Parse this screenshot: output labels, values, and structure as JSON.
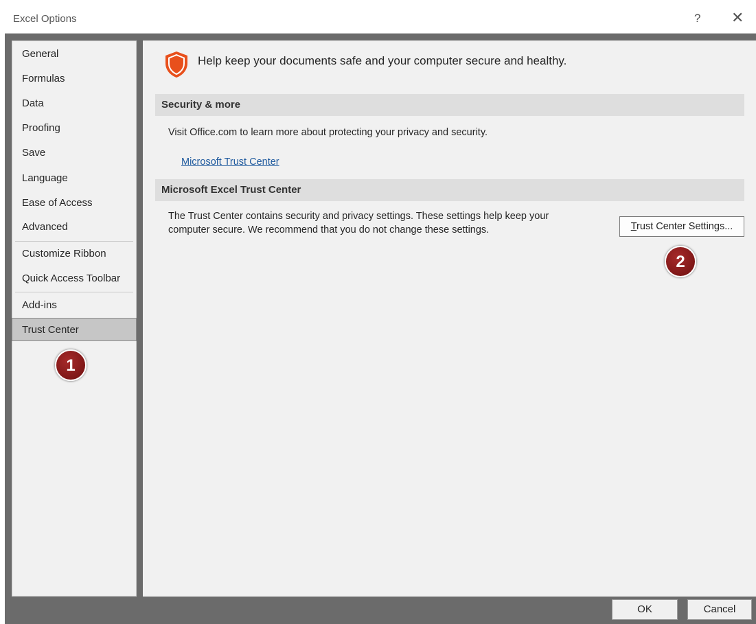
{
  "window": {
    "title": "Excel Options",
    "help_glyph": "?",
    "close_glyph": "✕"
  },
  "sidebar": {
    "items": [
      {
        "label": "General"
      },
      {
        "label": "Formulas"
      },
      {
        "label": "Data"
      },
      {
        "label": "Proofing"
      },
      {
        "label": "Save"
      },
      {
        "label": "Language"
      },
      {
        "label": "Ease of Access"
      },
      {
        "label": "Advanced"
      },
      {
        "label": "Customize Ribbon"
      },
      {
        "label": "Quick Access Toolbar"
      },
      {
        "label": "Add-ins"
      },
      {
        "label": "Trust Center",
        "selected": true
      }
    ]
  },
  "content": {
    "headline": "Help keep your documents safe and your computer secure and healthy.",
    "shield_icon": "shield-icon",
    "security_section": {
      "header": "Security & more",
      "text": "Visit Office.com to learn more about protecting your privacy and security.",
      "link": "Microsoft Trust Center"
    },
    "trust_center_section": {
      "header": "Microsoft Excel Trust Center",
      "text_line1": "The Trust Center contains security and privacy settings. These settings help keep your",
      "text_line2": "computer secure. We recommend that you do not change these settings.",
      "button_accesskey": "T",
      "button_rest": "rust Center Settings..."
    }
  },
  "annotations": {
    "step1": "1",
    "step2": "2"
  },
  "footer": {
    "ok_label": "OK",
    "cancel_label": "Cancel"
  },
  "colors": {
    "link": "#1f5a9e",
    "badge": "#8b1a1a",
    "shield": "#e8501c"
  }
}
